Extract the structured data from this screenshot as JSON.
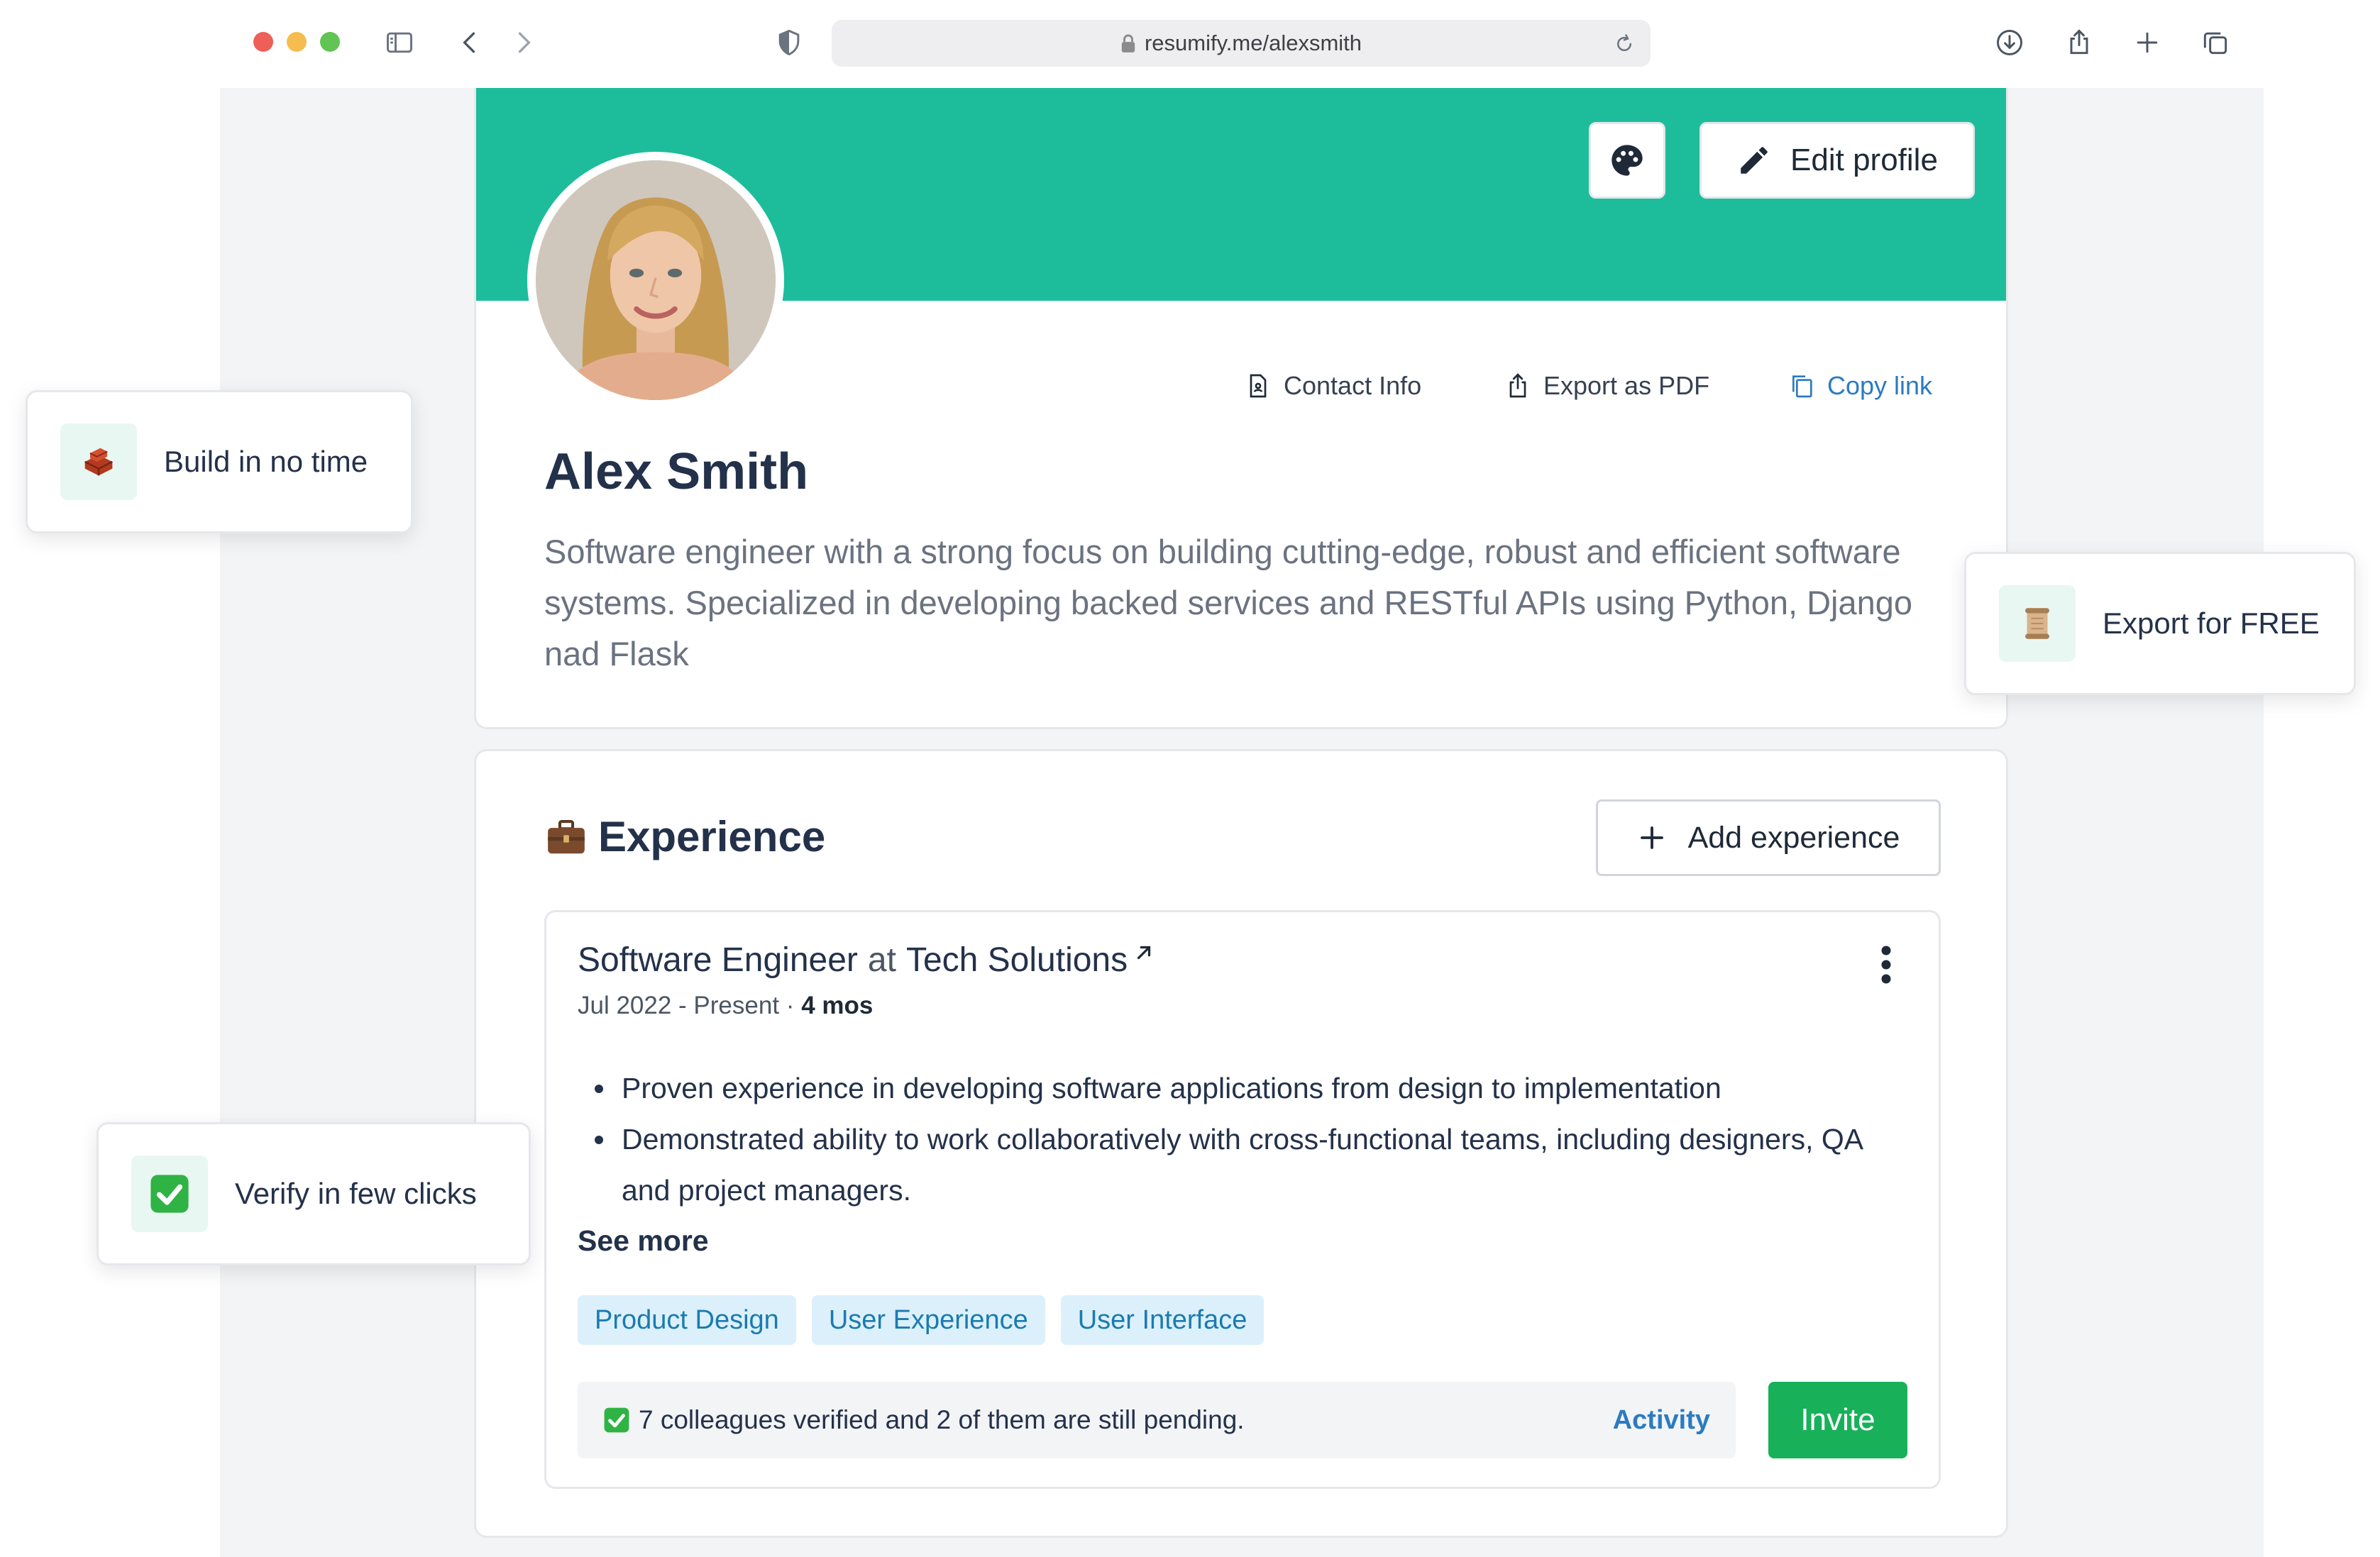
{
  "browser": {
    "url": "resumify.me/alexsmith"
  },
  "profile": {
    "edit_label": "Edit profile",
    "name": "Alex Smith",
    "bio": "Software engineer with a strong focus on building cutting-edge, robust and efficient software systems. Specialized in developing backed services and RESTful APIs using Python, Django nad Flask",
    "actions": {
      "contact": "Contact Info",
      "export": "Export as PDF",
      "copy": "Copy link"
    }
  },
  "experience": {
    "title": "Experience",
    "add_label": "Add experience",
    "job": {
      "role": "Software Engineer",
      "at": "at",
      "company": "Tech Solutions",
      "dates": "Jul 2022 - Present",
      "separator": "·",
      "duration": "4 mos",
      "bullets": [
        "Proven experience in developing software applications from design to implementation",
        "Demonstrated ability to work collaboratively with cross-functional teams, including designers, QA and project managers."
      ],
      "see_more": "See more",
      "tags": [
        "Product Design",
        "User Experience",
        "User Interface"
      ],
      "verification": "7 colleagues verified and 2 of them are still pending.",
      "activity_label": "Activity",
      "invite_label": "Invite"
    }
  },
  "callouts": {
    "build": "Build in no time",
    "export": "Export for FREE",
    "verify": "Verify in few clicks"
  },
  "colors": {
    "banner": "#1dbd9b",
    "invite": "#18b15a",
    "link": "#2b7bc0",
    "tag_bg": "#dcf0fb",
    "tag_text": "#1a7bb0"
  }
}
